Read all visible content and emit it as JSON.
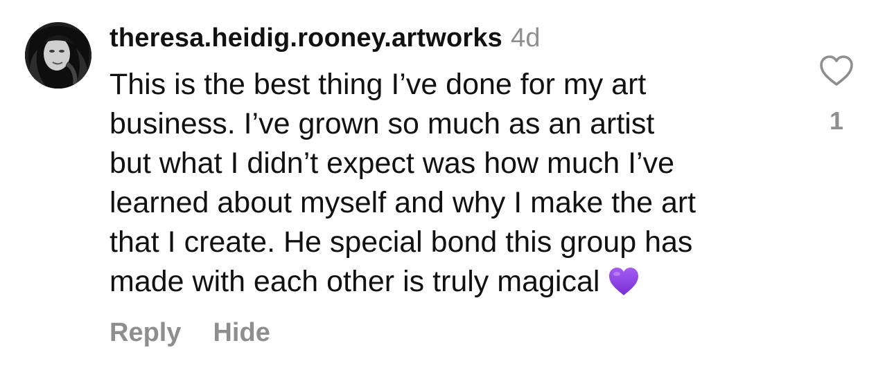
{
  "comment": {
    "username": "theresa.heidig.rooney.artworks",
    "timestamp": "4d",
    "text_lines": [
      "This is the best thing I’ve done for my art",
      "business. I’ve grown so much as an artist",
      "but what I didn’t expect was how much I’ve",
      "learned about myself and why I make the art",
      "that I create. He special bond this group has",
      "made with each other is truly magical"
    ],
    "emoji": "purple-heart-emoji",
    "like_count": "1"
  },
  "actions": {
    "reply_label": "Reply",
    "hide_label": "Hide"
  },
  "icons": {
    "like": "heart-outline-icon"
  },
  "colors": {
    "secondary_text": "#8e8e8e",
    "primary_text": "#111111",
    "emoji_purple": "#8a3ee0"
  }
}
